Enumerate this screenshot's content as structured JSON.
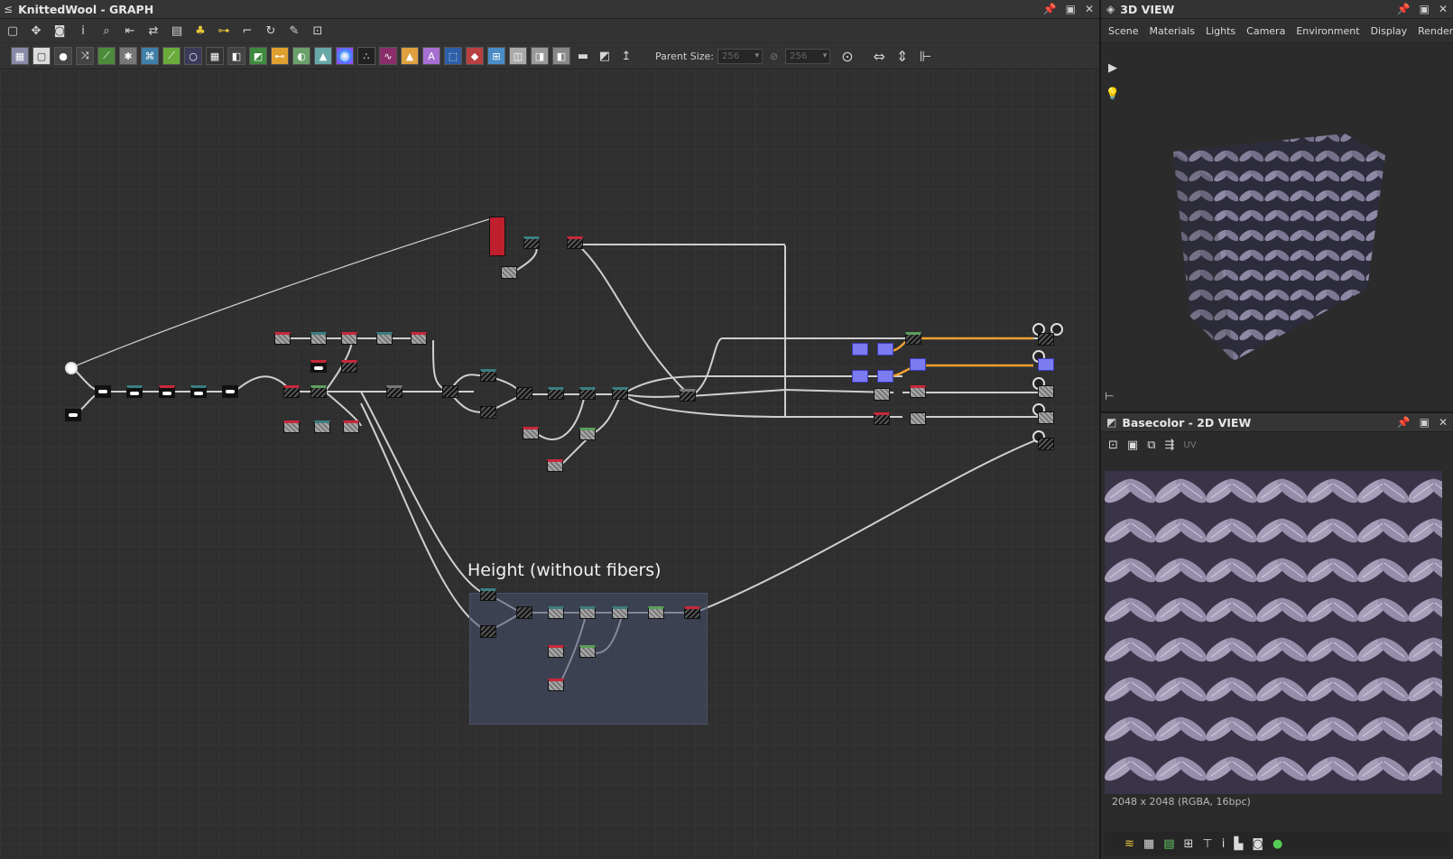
{
  "graph": {
    "title": "KnittedWool - GRAPH",
    "parent_size_label": "Parent Size:",
    "parent_size_value": "256",
    "parent_size_value2": "256",
    "frame_title": "Height (without fibers)"
  },
  "view3d": {
    "title": "3D VIEW",
    "menu": [
      "Scene",
      "Materials",
      "Lights",
      "Camera",
      "Environment",
      "Display",
      "Renderer"
    ]
  },
  "view2d": {
    "title": "Basecolor - 2D VIEW",
    "uv_label": "UV",
    "resolution": "2048 x 2048 (RGBA, 16bpc)"
  },
  "colors": {
    "accent_orange": "#f0a030",
    "node_blue": "#7b7cf2",
    "frame_fill": "#46506e",
    "header_red": "#c8283a"
  }
}
